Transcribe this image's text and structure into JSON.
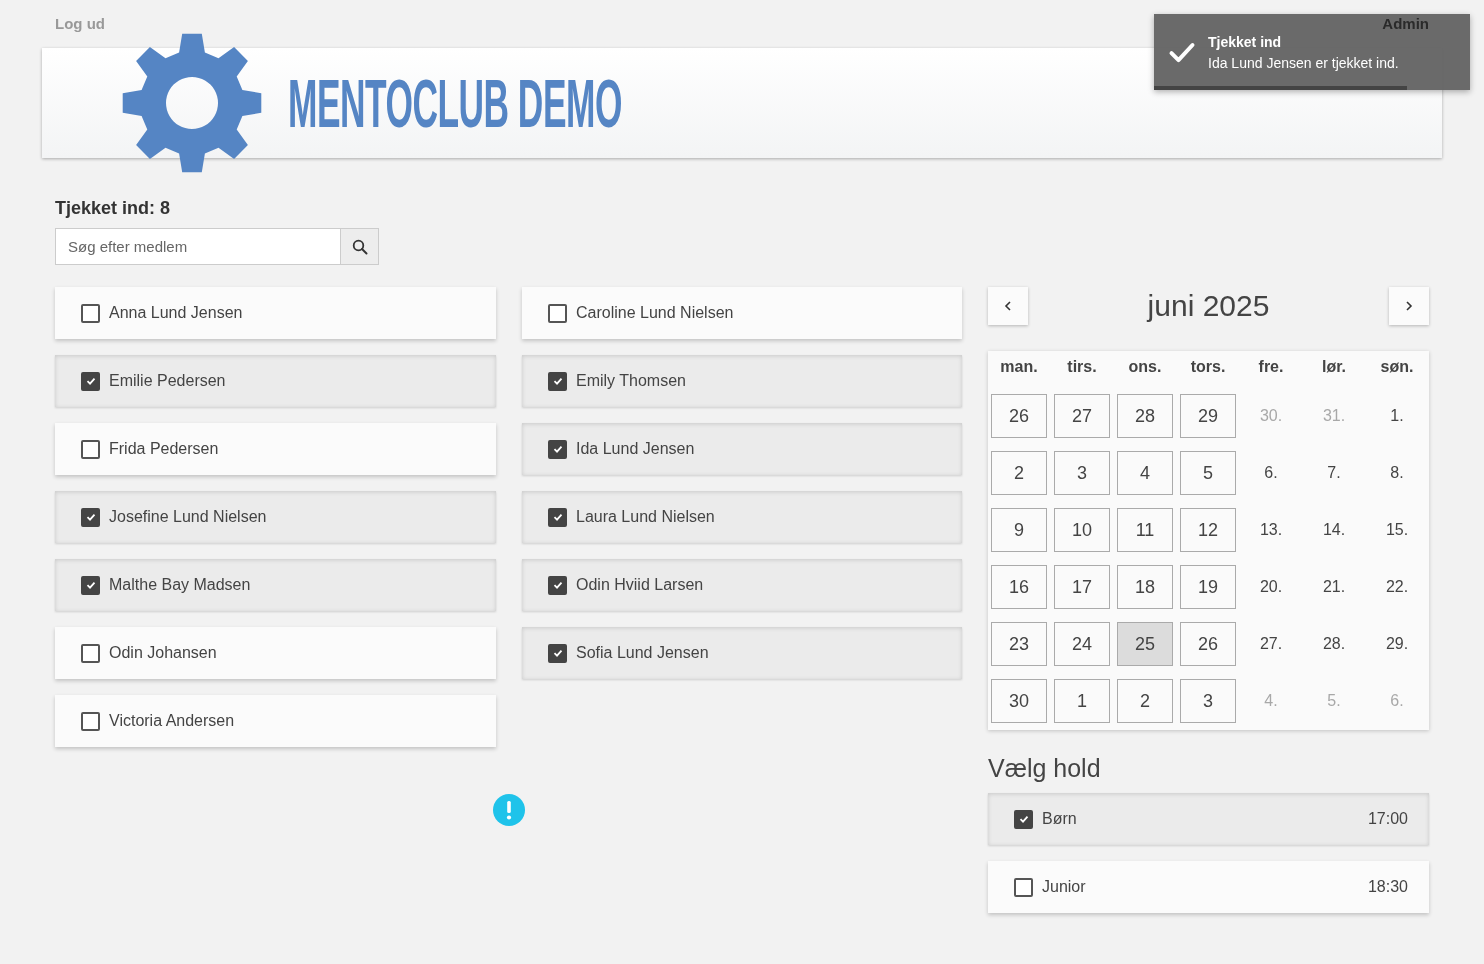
{
  "top_bar": {
    "logout": "Log ud",
    "admin": "Admin"
  },
  "banner": {
    "title": "MENTOCLUB DEMO"
  },
  "toast": {
    "title": "Tjekket ind",
    "message": "Ida Lund Jensen er tjekket ind.",
    "level": 0.8
  },
  "checked_in": "Tjekket ind: 8",
  "search": {
    "placeholder": "Søg efter medlem"
  },
  "members": [
    {
      "name": "Anna Lund Jensen",
      "checked": false
    },
    {
      "name": "Caroline Lund Nielsen",
      "checked": false
    },
    {
      "name": "Emilie Pedersen",
      "checked": true
    },
    {
      "name": "Emily Thomsen",
      "checked": true
    },
    {
      "name": "Frida Pedersen",
      "checked": false
    },
    {
      "name": "Ida Lund Jensen",
      "checked": true
    },
    {
      "name": "Josefine Lund Nielsen",
      "checked": true
    },
    {
      "name": "Laura Lund Nielsen",
      "checked": true
    },
    {
      "name": "Malthe Bay Madsen",
      "checked": true
    },
    {
      "name": "Odin Hviid Larsen",
      "checked": true
    },
    {
      "name": "Odin Johansen",
      "checked": false
    },
    {
      "name": "Sofia Lund Jensen",
      "checked": true
    },
    {
      "name": "Victoria Andersen",
      "checked": false
    }
  ],
  "calendar": {
    "title": "juni 2025",
    "weekdays": [
      "man.",
      "tirs.",
      "ons.",
      "tors.",
      "fre.",
      "lør.",
      "søn."
    ],
    "days": [
      {
        "label": "26",
        "kind": "box",
        "muted": false,
        "selected": false
      },
      {
        "label": "27",
        "kind": "box",
        "muted": false,
        "selected": false
      },
      {
        "label": "28",
        "kind": "box",
        "muted": false,
        "selected": false
      },
      {
        "label": "29",
        "kind": "box",
        "muted": false,
        "selected": false
      },
      {
        "label": "30.",
        "kind": "plain",
        "muted": true,
        "selected": false
      },
      {
        "label": "31.",
        "kind": "plain",
        "muted": true,
        "selected": false
      },
      {
        "label": "1.",
        "kind": "plain",
        "muted": false,
        "selected": false
      },
      {
        "label": "2",
        "kind": "box",
        "muted": false,
        "selected": false
      },
      {
        "label": "3",
        "kind": "box",
        "muted": false,
        "selected": false
      },
      {
        "label": "4",
        "kind": "box",
        "muted": false,
        "selected": false
      },
      {
        "label": "5",
        "kind": "box",
        "muted": false,
        "selected": false
      },
      {
        "label": "6.",
        "kind": "plain",
        "muted": false,
        "selected": false
      },
      {
        "label": "7.",
        "kind": "plain",
        "muted": false,
        "selected": false
      },
      {
        "label": "8.",
        "kind": "plain",
        "muted": false,
        "selected": false
      },
      {
        "label": "9",
        "kind": "box",
        "muted": false,
        "selected": false
      },
      {
        "label": "10",
        "kind": "box",
        "muted": false,
        "selected": false
      },
      {
        "label": "11",
        "kind": "box",
        "muted": false,
        "selected": false
      },
      {
        "label": "12",
        "kind": "box",
        "muted": false,
        "selected": false
      },
      {
        "label": "13.",
        "kind": "plain",
        "muted": false,
        "selected": false
      },
      {
        "label": "14.",
        "kind": "plain",
        "muted": false,
        "selected": false
      },
      {
        "label": "15.",
        "kind": "plain",
        "muted": false,
        "selected": false
      },
      {
        "label": "16",
        "kind": "box",
        "muted": false,
        "selected": false
      },
      {
        "label": "17",
        "kind": "box",
        "muted": false,
        "selected": false
      },
      {
        "label": "18",
        "kind": "box",
        "muted": false,
        "selected": false
      },
      {
        "label": "19",
        "kind": "box",
        "muted": false,
        "selected": false
      },
      {
        "label": "20.",
        "kind": "plain",
        "muted": false,
        "selected": false
      },
      {
        "label": "21.",
        "kind": "plain",
        "muted": false,
        "selected": false
      },
      {
        "label": "22.",
        "kind": "plain",
        "muted": false,
        "selected": false
      },
      {
        "label": "23",
        "kind": "box",
        "muted": false,
        "selected": false
      },
      {
        "label": "24",
        "kind": "box",
        "muted": false,
        "selected": false
      },
      {
        "label": "25",
        "kind": "box",
        "muted": false,
        "selected": true
      },
      {
        "label": "26",
        "kind": "box",
        "muted": false,
        "selected": false
      },
      {
        "label": "27.",
        "kind": "plain",
        "muted": false,
        "selected": false
      },
      {
        "label": "28.",
        "kind": "plain",
        "muted": false,
        "selected": false
      },
      {
        "label": "29.",
        "kind": "plain",
        "muted": false,
        "selected": false
      },
      {
        "label": "30",
        "kind": "box",
        "muted": false,
        "selected": false
      },
      {
        "label": "1",
        "kind": "box",
        "muted": false,
        "selected": false
      },
      {
        "label": "2",
        "kind": "box",
        "muted": false,
        "selected": false
      },
      {
        "label": "3",
        "kind": "box",
        "muted": false,
        "selected": false
      },
      {
        "label": "4.",
        "kind": "plain",
        "muted": true,
        "selected": false
      },
      {
        "label": "5.",
        "kind": "plain",
        "muted": true,
        "selected": false
      },
      {
        "label": "6.",
        "kind": "plain",
        "muted": true,
        "selected": false
      }
    ]
  },
  "teams": {
    "heading": "Vælg hold",
    "items": [
      {
        "name": "Børn",
        "time": "17:00",
        "checked": true
      },
      {
        "name": "Junior",
        "time": "18:30",
        "checked": false
      }
    ]
  }
}
